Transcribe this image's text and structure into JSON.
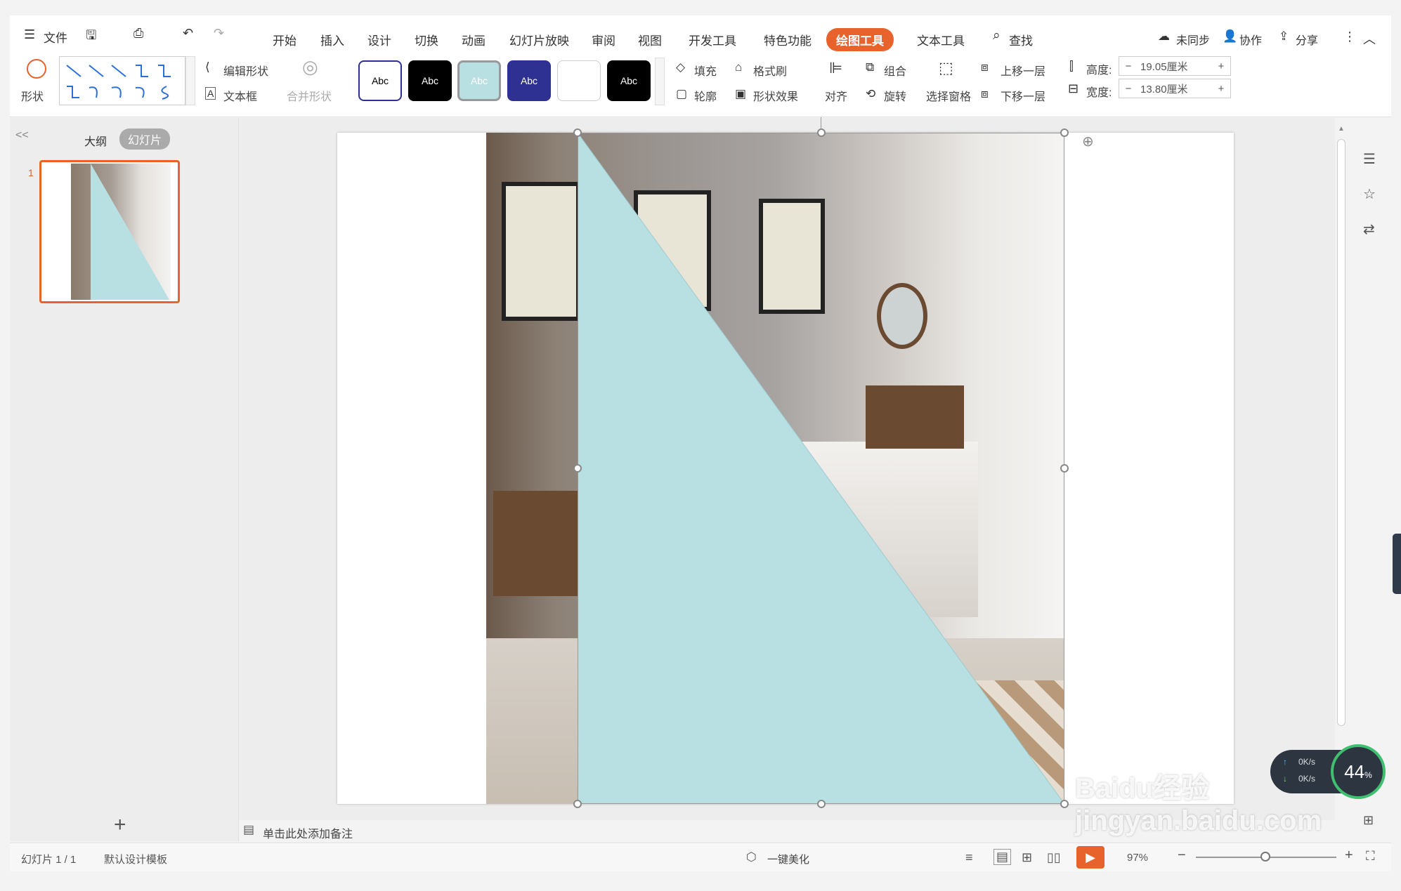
{
  "menu": {
    "file": "文件",
    "tabs": [
      "开始",
      "插入",
      "设计",
      "切换",
      "动画",
      "幻灯片放映",
      "审阅",
      "视图",
      "开发工具",
      "特色功能",
      "绘图工具",
      "文本工具"
    ],
    "active_tab": "绘图工具",
    "search": "查找",
    "sync": "未同步",
    "collab": "协作",
    "share": "分享"
  },
  "ribbon": {
    "shape": "形状",
    "edit_shape": "编辑形状",
    "textbox": "文本框",
    "merge_shape": "合并形状",
    "style_labels": [
      "Abc",
      "Abc",
      "Abc",
      "Abc",
      "",
      "Abc"
    ],
    "fill": "填充",
    "format_painter": "格式刷",
    "outline": "轮廓",
    "shape_effect": "形状效果",
    "align": "对齐",
    "group": "组合",
    "rotate": "旋转",
    "select_pane": "选择窗格",
    "bring_forward": "上移一层",
    "send_backward": "下移一层",
    "height_label": "高度:",
    "height_value": "19.05厘米",
    "width_label": "宽度:",
    "width_value": "13.80厘米",
    "minus": "−",
    "plus": "+"
  },
  "sidebar": {
    "collapse": "<<",
    "outline_tab": "大纲",
    "slides_tab": "幻灯片",
    "slide_number": "1",
    "add": "+"
  },
  "notes_placeholder": "单击此处添加备注",
  "status": {
    "slide_info": "幻灯片 1 / 1",
    "template": "默认设计模板",
    "beautify": "一键美化",
    "zoom": "97%"
  },
  "net_widget": {
    "up": "0K/s",
    "down": "0K/s",
    "percent": "44",
    "unit": "%"
  },
  "watermark": "Baidu经验 jingyan.baidu.com",
  "colors": {
    "accent": "#e8622c",
    "triangle": "#b8dfe2",
    "style_selected": "#b8dfe2",
    "style_blue": "#2e3192"
  }
}
